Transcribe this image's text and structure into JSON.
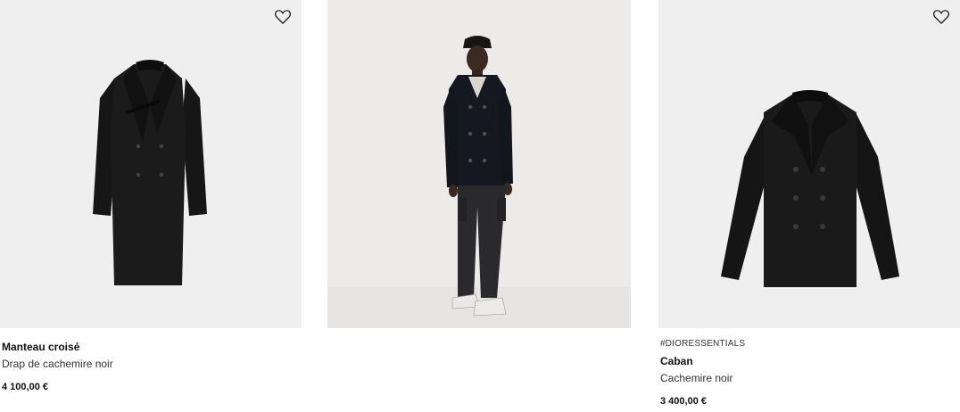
{
  "products": [
    {
      "tag": "",
      "name": "Manteau croisé",
      "description": "Drap de cachemire noir",
      "price": "4 100,00 €",
      "wishlist_icon": "heart-outline-icon"
    },
    {
      "tag": "#DIORESSENTIALS",
      "name": "Caban",
      "description": "Cachemire noir",
      "price": "3 400,00 €",
      "wishlist_icon": "heart-outline-icon"
    }
  ],
  "colors": {
    "background": "#ffffff",
    "image_bg": "#efeff0",
    "garment": "#1a1a1a",
    "text": "#111111"
  }
}
